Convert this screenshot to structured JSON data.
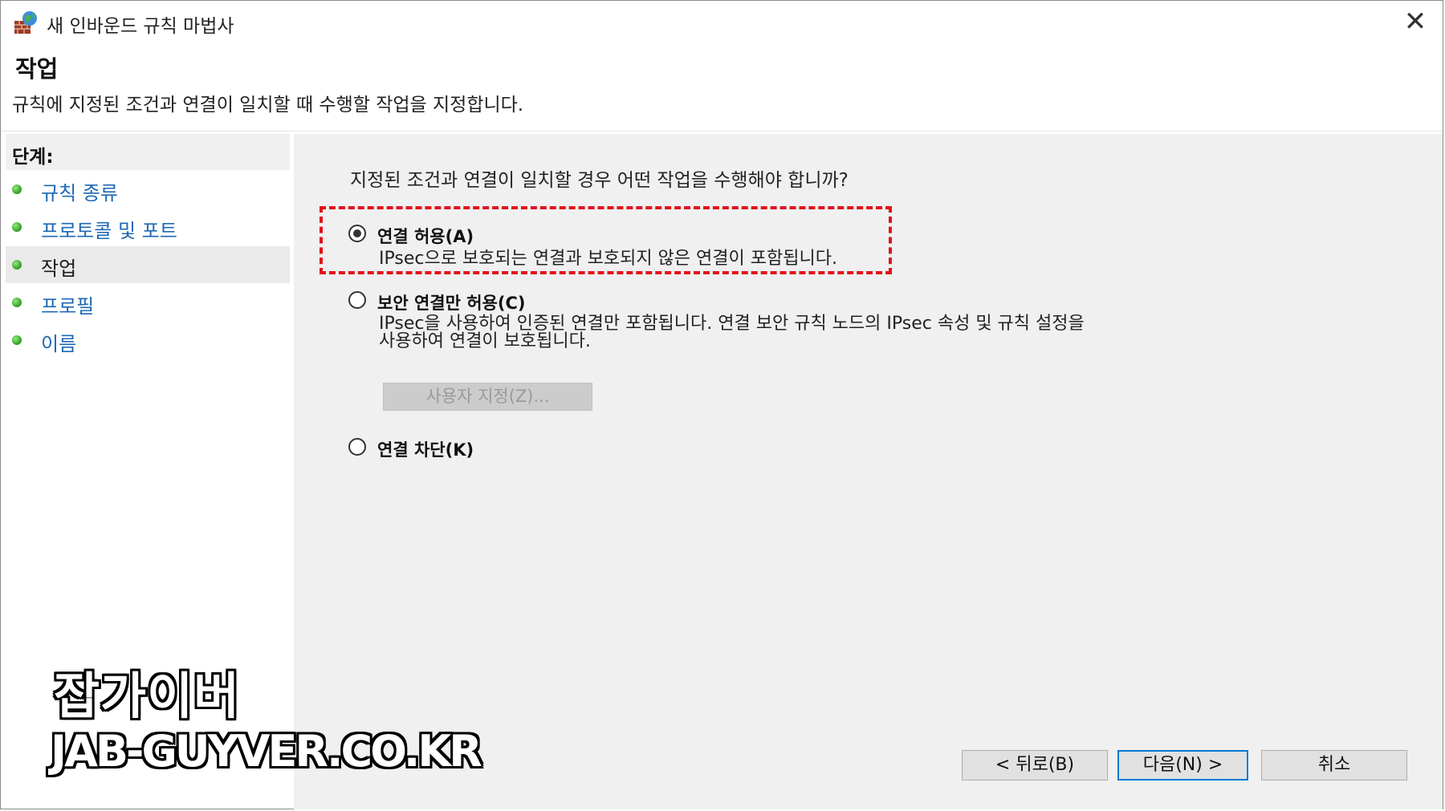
{
  "window": {
    "title": "새 인바운드 규칙 마법사",
    "close_glyph": "✕",
    "icon": "firewall-globe-icon"
  },
  "header": {
    "title": "작업",
    "description": "규칙에 지정된 조건과 연결이 일치할 때 수행할 작업을 지정합니다."
  },
  "steps": {
    "title": "단계:",
    "items": [
      {
        "label": "규칙 종류",
        "current": false
      },
      {
        "label": "프로토콜 및 포트",
        "current": false
      },
      {
        "label": "작업",
        "current": true
      },
      {
        "label": "프로필",
        "current": false
      },
      {
        "label": "이름",
        "current": false
      }
    ]
  },
  "main": {
    "question": "지정된 조건과 연결이 일치할 경우 어떤 작업을 수행해야 합니까?",
    "options": [
      {
        "label": "연결 허용(A)",
        "description": "IPsec으로 보호되는 연결과 보호되지 않은 연결이 포함됩니다.",
        "checked": true
      },
      {
        "label": "보안 연결만 허용(C)",
        "description_line1": "IPsec을 사용하여 인증된 연결만 포함됩니다. 연결 보안 규칙 노드의 IPsec 속성 및 규칙 설정을",
        "description_line2": "사용하여 연결이 보호됩니다.",
        "checked": false
      },
      {
        "label": "연결 차단(K)",
        "checked": false
      }
    ],
    "customize_button": "사용자 지정(Z)...",
    "highlight_color": "#e0141c"
  },
  "footer": {
    "back_button": "< 뒤로(B)",
    "next_button": "다음(N) >",
    "cancel_button": "취소"
  },
  "watermark": {
    "korean": "잡가이버",
    "url": "JAB-GUYVER.CO.KR"
  }
}
